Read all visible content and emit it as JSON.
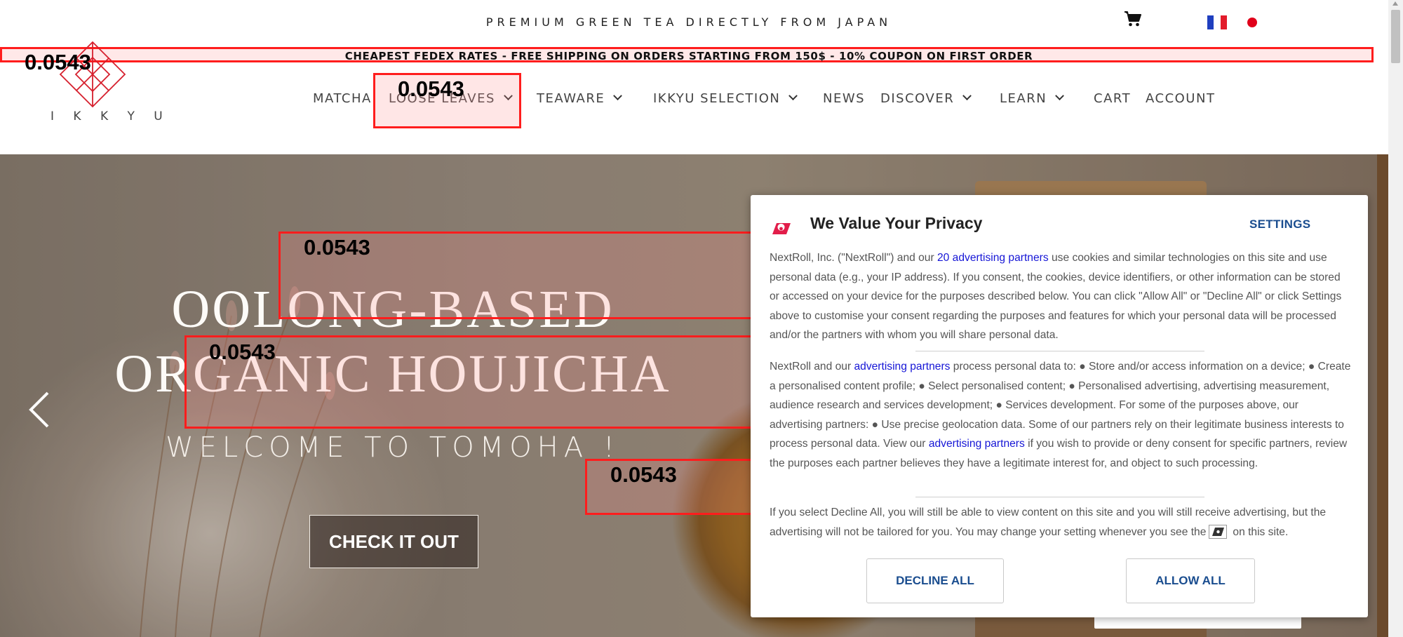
{
  "topbar": {
    "tagline": "PREMIUM GREEN TEA DIRECTLY FROM JAPAN",
    "cart_icon": "cart-icon",
    "flags": [
      "flag-france-icon",
      "flag-japan-icon"
    ]
  },
  "banner": {
    "text": "CHEAPEST FEDEX RATES - FREE SHIPPING ON ORDERS STARTING FROM 150$ - 10% COUPON ON FIRST ORDER"
  },
  "logo": {
    "wordmark": "I K K Y U",
    "icon": "ikkyu-diamond-logo"
  },
  "nav": {
    "items": [
      {
        "label": "MATCHA",
        "has_dropdown": false
      },
      {
        "label": "LOOSE LEAVES",
        "has_dropdown": true
      },
      {
        "label": "TEAWARE",
        "has_dropdown": true
      },
      {
        "label": "IKKYU SELECTION",
        "has_dropdown": true
      },
      {
        "label": "NEWS",
        "has_dropdown": false
      },
      {
        "label": "DISCOVER",
        "has_dropdown": true
      },
      {
        "label": "LEARN",
        "has_dropdown": true
      },
      {
        "label": "CART",
        "has_dropdown": false
      },
      {
        "label": "ACCOUNT",
        "has_dropdown": false
      }
    ]
  },
  "annotations": {
    "labels": [
      "0.0543",
      "0.0543",
      "0.0543",
      "0.0543",
      "0.0543"
    ],
    "color": "#ff1d1d"
  },
  "hero": {
    "title_line1": "OOLONG-BASED",
    "title_line2": "ORGANIC HOUJICHA",
    "subtitle": "WELCOME TO TOMOHA !",
    "cta": "CHECK IT OUT",
    "prev_icon": "chevron-left-icon"
  },
  "cookie": {
    "title": "We Value Your Privacy",
    "settings_label": "SETTINGS",
    "p1_a": "NextRoll, Inc. (\"NextRoll\") and our ",
    "p1_link": "20 advertising partners",
    "p1_b": " use cookies and similar technologies on this site and use personal data (e.g., your IP address). If you consent, the cookies, device identifiers, or other information can be stored or accessed on your device for the purposes described below. You can click \"Allow All\" or \"Decline All\" or click Settings above to customise your consent regarding the purposes and features for which your personal data will be processed and/or the partners with whom you will share personal data.",
    "p2_a": "NextRoll and our ",
    "p2_link1": "advertising partners",
    "p2_b": " process personal data to: ● Store and/or access information on a device; ● Create a personalised content profile; ● Select personalised content; ● Personalised advertising, advertising measurement, audience research and services development; ● Services development. For some of the purposes above, our advertising partners: ● Use precise geolocation data. Some of our partners rely on their legitimate business interests to process personal data. View our ",
    "p2_link2": "advertising partners",
    "p2_c": " if you wish to provide or deny consent for specific partners, review the purposes each partner believes they have a legitimate interest for, and object to such processing.",
    "p3_a": "If you select Decline All, you will still be able to view content on this site and you will still receive advertising, but the advertising will not be tailored for you. You may change your setting whenever you see the",
    "p3_b": "on this site.",
    "decline_label": "DECLINE ALL",
    "allow_label": "ALLOW ALL",
    "accent_color": "#1a4d8f",
    "link_color": "#1515d6"
  }
}
